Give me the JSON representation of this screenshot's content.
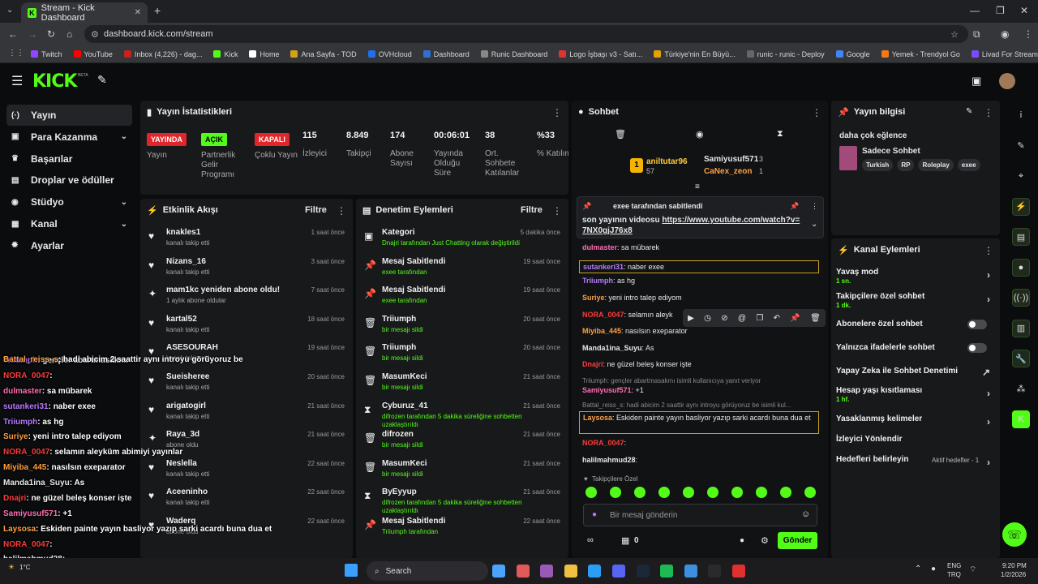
{
  "browser": {
    "tab_title": "Stream - Kick Dashboard",
    "url": "dashboard.kick.com/stream",
    "bookmarks": [
      "Twitch",
      "YouTube",
      "Inbox (4,226) - dag...",
      "Kick",
      "Home",
      "Ana Sayfa - TOD",
      "OVHcloud",
      "Dashboard",
      "Runic Dashboard",
      "Logo İşbaşı v3 - Satı...",
      "Türkiye'nin En Büyü...",
      "runic - runic - Deploy",
      "Google",
      "Yemek - Trendyol Go",
      "Livad For Streamers"
    ],
    "bookmark_colors": [
      "#9146ff",
      "#ff0000",
      "#c5221f",
      "#53fc18",
      "#ffffff",
      "#d4a017",
      "#1f6feb",
      "#2f6fd6",
      "#888888",
      "#d33",
      "#e8a000",
      "#666666",
      "#4285f4",
      "#f27a1a",
      "#7a4cff"
    ]
  },
  "brand": {
    "logo": "KICK",
    "beta": "BETA"
  },
  "sidebar": [
    {
      "label": "Yayın",
      "icon": "(·)"
    },
    {
      "label": "Para Kazanma",
      "icon": "▣"
    },
    {
      "label": "Başarılar",
      "icon": "♛"
    },
    {
      "label": "Droplar ve ödüller",
      "icon": "▤"
    },
    {
      "label": "Stüdyo",
      "icon": "◉"
    },
    {
      "label": "Kanal",
      "icon": "▦"
    },
    {
      "label": "Ayarlar",
      "icon": "✹"
    }
  ],
  "stats": {
    "title": "Yayın İstatistikleri",
    "badges": [
      {
        "text": "YAYINDA",
        "label": "Yayın"
      },
      {
        "text": "AÇIK",
        "label": "Partnerlik Gelir Programı"
      },
      {
        "text": "KAPALI",
        "label": "Çoklu Yayın"
      }
    ],
    "numbers": [
      {
        "value": "115",
        "label": "İzleyici"
      },
      {
        "value": "8.849",
        "label": "Takipçi"
      },
      {
        "value": "174",
        "label": "Abone Sayısı"
      },
      {
        "value": "00:06:01",
        "label": "Yayında Olduğu Süre"
      },
      {
        "value": "38",
        "label": "Ort. Sohbete Katılanlar"
      },
      {
        "value": "%33",
        "label": "% Katılım"
      }
    ]
  },
  "activity": {
    "title": "Etkinlik Akışı",
    "filter": "Filtre",
    "items": [
      {
        "name": "knakles1",
        "sub": "kanalı takip etti",
        "time": "1 saat önce"
      },
      {
        "name": "Nizans_16",
        "sub": "kanalı takip etti",
        "time": "3 saat önce"
      },
      {
        "name": "mam1kc yeniden abone oldu!",
        "sub": "1 aylık abone oldular",
        "time": "7 saat önce"
      },
      {
        "name": "kartal52",
        "sub": "kanalı takip etti",
        "time": "18 saat önce"
      },
      {
        "name": "ASESOURAH",
        "sub": "kanalı takip etti",
        "time": "19 saat önce"
      },
      {
        "name": "Sueisheree",
        "sub": "kanalı takip etti",
        "time": "20 saat önce"
      },
      {
        "name": "arigatogirl",
        "sub": "kanalı takip etti",
        "time": "21 saat önce"
      },
      {
        "name": "Raya_3d",
        "sub": "abone oldu",
        "time": "21 saat önce"
      },
      {
        "name": "Neslella",
        "sub": "kanalı takip etti",
        "time": "22 saat önce"
      },
      {
        "name": "Aceeninho",
        "sub": "kanalı takip etti",
        "time": "22 saat önce"
      },
      {
        "name": "Waderq",
        "sub": "abone oldu",
        "time": "22 saat önce"
      }
    ]
  },
  "moderation": {
    "title": "Denetim Eylemleri",
    "filter": "Filtre",
    "items": [
      {
        "title": "Kategori",
        "sub": "Dnajri tarafından Just Chatting olarak değiştirildi",
        "time": "5 dakika önce"
      },
      {
        "title": "Mesaj Sabitlendi",
        "sub": "exee tarafından",
        "time": "19 saat önce"
      },
      {
        "title": "Mesaj Sabitlendi",
        "sub": "exee tarafından",
        "time": "19 saat önce"
      },
      {
        "title": "Triiumph",
        "sub": "bir mesajı sildi",
        "time": "20 saat önce"
      },
      {
        "title": "Triiumph",
        "sub": "bir mesajı sildi",
        "time": "20 saat önce"
      },
      {
        "title": "MasumKeci",
        "sub": "bir mesajı sildi",
        "time": "21 saat önce"
      },
      {
        "title": "Cyburuz_41",
        "sub": "difrozen tarafından 5 dakika süreliğine sohbetten uzaklaştırıldı",
        "time": "21 saat önce"
      },
      {
        "title": "difrozen",
        "sub": "bir mesajı sildi",
        "time": "21 saat önce"
      },
      {
        "title": "MasumKeci",
        "sub": "bir mesajı sildi",
        "time": "21 saat önce"
      },
      {
        "title": "ByEyyup",
        "sub": "difrozen tarafından 5 dakika süreliğine sohbetten uzaklaştırıldı",
        "time": "21 saat önce"
      },
      {
        "title": "Mesaj Sabitlendi",
        "sub": "Triiumph tarafından",
        "time": "22 saat önce"
      }
    ]
  },
  "chat": {
    "title": "Sohbet",
    "top": [
      {
        "name": "aniltutar96",
        "count": "57"
      },
      {
        "name": "Samiyusuf571",
        "count": "3"
      },
      {
        "name": "CaNex_zeon",
        "count": "1"
      }
    ],
    "pinned": {
      "by": "exee tarafından sabitlendi",
      "text": "son yayının videosu ",
      "link": "https://www.youtube.com/watch?v=7NX0gjJ76x8"
    },
    "messages": [
      {
        "user": "dulmaster",
        "text": ": sa mübarek",
        "color": "#ff6eb4"
      },
      {
        "user": "sutankeri31",
        "text": ": naber exee",
        "color": "#b57bff"
      },
      {
        "user": "Triiumph",
        "text": ": as hg",
        "color": "#b57bff"
      },
      {
        "user": "Suriye",
        "text": ": yeni intro talep ediyom",
        "color": "#ff9f43"
      },
      {
        "user": "NORA_0047",
        "text": ": selamın aleyk",
        "color": "#ff3b3b"
      },
      {
        "user": "Miyiba_445",
        "text": ": nasılsın exeparator",
        "color": "#ff9f43"
      },
      {
        "user": "Manda1ina_Suyu",
        "text": ": As",
        "color": "#e8e8e8"
      },
      {
        "user": "Dnajri",
        "text": ": ne güzel beleş konser işte",
        "color": "#ff3b3b"
      },
      {
        "user": "Samiyusuf571",
        "text": ": +1",
        "color": "#ff6eb4"
      },
      {
        "user": "Laysosa",
        "text": ": Eskiden painte yayın basliyor yazıp sarki acardı buna dua et",
        "color": "#ff9f43"
      },
      {
        "user": "NORA_0047",
        "text": ":",
        "color": "#ff3b3b"
      },
      {
        "user": "halilmahmud28",
        "text": ":",
        "color": "#e8e8e8"
      }
    ],
    "replies": [
      "Triiumph: gençler abartmasakmı isimli kullanıcıya yanıt veriyor",
      "Battal_reiss_s: hadi abicim 2 saattir aynı introyu görüyoruz be isimli kul..."
    ],
    "followers_only": "Takipçilere Özel",
    "placeholder": "Bir mesaj gönderin",
    "points": "0",
    "send": "Gönder"
  },
  "overlay": [
    {
      "user": "Battal_reiss_s",
      "text": ": hadi abicim 2 saattir aynı introyu görüyoruz be",
      "color": "#ff9f43"
    },
    {
      "user": "Triiumph",
      "text": ": gençler abartmasakmı",
      "color": "#b57bff"
    },
    {
      "user": "NORA_0047",
      "text": ":",
      "color": "#ff3b3b"
    },
    {
      "user": "dulmaster",
      "text": ": sa mübarek",
      "color": "#ff6eb4"
    },
    {
      "user": "sutankeri31",
      "text": ": naber exee",
      "color": "#b57bff"
    },
    {
      "user": "Triiumph",
      "text": ": as hg",
      "color": "#b57bff"
    },
    {
      "user": "Suriye",
      "text": ": yeni intro talep ediyom",
      "color": "#ff9f43"
    },
    {
      "user": "NORA_0047",
      "text": ": selamın aleyküm abimiyi yayınlar",
      "color": "#ff3b3b"
    },
    {
      "user": "Miyiba_445",
      "text": ": nasılsın exeparator",
      "color": "#ff9f43"
    },
    {
      "user": "Manda1ina_Suyu",
      "text": ": As",
      "color": "#e8e8e8"
    },
    {
      "user": "Dnajri",
      "text": ": ne güzel beleş konser işte",
      "color": "#ff3b3b"
    },
    {
      "user": "Samiyusuf571",
      "text": ": +1",
      "color": "#ff6eb4"
    },
    {
      "user": "Laysosa",
      "text": ": Eskiden painte yayın basliyor yazıp sarki acardı buna dua et",
      "color": "#ff9f43"
    },
    {
      "user": "NORA_0047",
      "text": ":",
      "color": "#ff3b3b"
    },
    {
      "user": "halilmahmud28",
      "text": ":",
      "color": "#e8e8e8"
    }
  ],
  "stream_info": {
    "title": "Yayın bilgisi",
    "stream_title": "daha çok eğlence",
    "category": "Sadece Sohbet",
    "tags": [
      "Turkish",
      "RP",
      "Roleplay",
      "exee"
    ]
  },
  "channel_actions": {
    "title": "Kanal Eylemleri",
    "rows": [
      {
        "label": "Yavaş mod",
        "sub": "1 sn.",
        "kind": "arrow"
      },
      {
        "label": "Takipçilere özel sohbet",
        "sub": "1 dk.",
        "kind": "arrow"
      },
      {
        "label": "Abonelere özel sohbet",
        "sub": "",
        "kind": "toggle"
      },
      {
        "label": "Yalnızca ifadelerle sohbet",
        "sub": "",
        "kind": "toggle"
      },
      {
        "label": "Yapay Zeka ile Sohbet Denetimi",
        "sub": "",
        "kind": "ext"
      },
      {
        "label": "Hesap yaşı kısıtlaması",
        "sub": "1 hf.",
        "kind": "arrow"
      },
      {
        "label": "Yasaklanmış kelimeler",
        "sub": "",
        "kind": "arrow"
      },
      {
        "label": "İzleyici Yönlendir",
        "sub": "",
        "kind": "none"
      },
      {
        "label": "Hedefleri belirleyin",
        "sub": "",
        "kind": "arrow"
      }
    ],
    "goals_status": "Aktif hedefler - 1"
  },
  "taskbar": {
    "search": "Search",
    "weather": "1°C",
    "lang1": "ENG",
    "lang2": "TRQ",
    "time": "9:20 PM",
    "date": "1/2/2026"
  },
  "colors": {
    "accent": "#53fc18",
    "live": "#e0262a",
    "panel": "#18191b"
  }
}
